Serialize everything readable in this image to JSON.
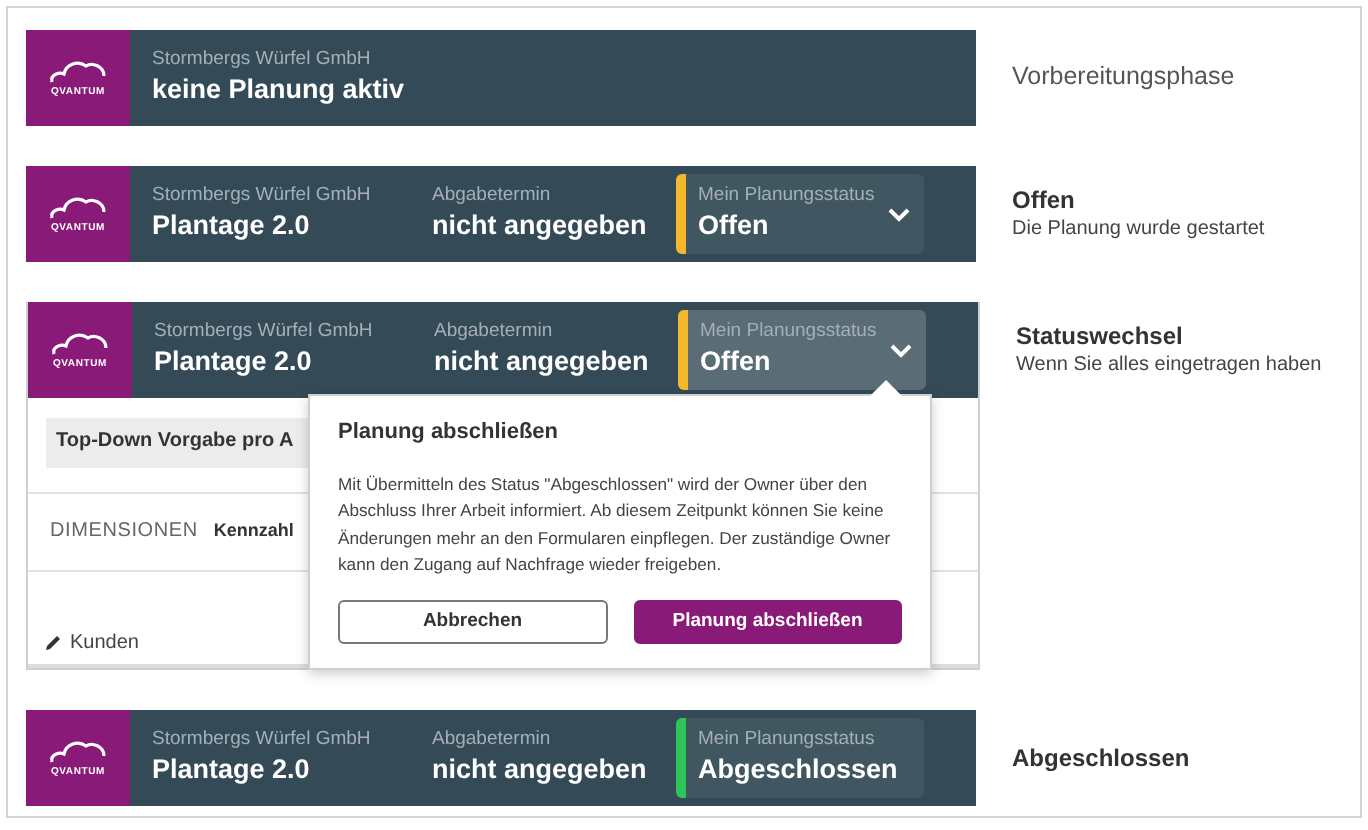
{
  "rows": [
    {
      "logo_text": "QVANTUM",
      "company": "Stormbergs Würfel GmbH",
      "project": "keine Planung aktiv",
      "caption": {
        "title": "Vorbereitungsphase",
        "emphasized": false
      }
    },
    {
      "logo_text": "QVANTUM",
      "company": "Stormbergs Würfel GmbH",
      "project": "Plantage 2.0",
      "deadline_label": "Abgabetermin",
      "deadline": "nicht angegeben",
      "status": {
        "label": "Mein Planungsstatus",
        "value": "Offen",
        "color": "#f4b92a",
        "dropdown": true,
        "expanded": false
      },
      "caption": {
        "title": "Offen",
        "subtitle": "Die Planung wurde gestartet",
        "emphasized": true
      }
    },
    {
      "logo_text": "QVANTUM",
      "company": "Stormbergs Würfel GmbH",
      "project": "Plantage 2.0",
      "deadline_label": "Abgabetermin",
      "deadline": "nicht angegeben",
      "status": {
        "label": "Mein Planungsstatus",
        "value": "Offen",
        "color": "#f4b92a",
        "dropdown": true,
        "expanded": true
      },
      "caption": {
        "title": "Statuswechsel",
        "subtitle": "Wenn Sie alles eingetragen haben",
        "emphasized": true
      },
      "app": {
        "field": "Top-Down Vorgabe pro A",
        "tabs": [
          {
            "label": "DIMENSIONEN",
            "selected": false
          },
          {
            "label": "Kennzahl",
            "selected": true
          }
        ],
        "item": "Kunden"
      },
      "popover": {
        "title": "Planung abschließen",
        "text": "Mit Übermitteln des Status \"Abgeschlossen\" wird der Owner über den Abschluss Ihrer Arbeit informiert. Ab diesem Zeitpunkt können Sie keine Änderungen mehr an den Formularen einpflegen. Der zuständige Owner kann den Zugang auf Nachfrage wieder freigeben.",
        "cancel": "Abbrechen",
        "confirm": "Planung abschließen"
      }
    },
    {
      "logo_text": "QVANTUM",
      "company": "Stormbergs Würfel GmbH",
      "project": "Plantage 2.0",
      "deadline_label": "Abgabetermin",
      "deadline": "nicht angegeben",
      "status": {
        "label": "Mein Planungsstatus",
        "value": "Abgeschlossen",
        "color": "#2ec45a",
        "dropdown": false,
        "expanded": false
      },
      "caption": {
        "title": "Abgeschlossen",
        "emphasized": true
      }
    }
  ]
}
